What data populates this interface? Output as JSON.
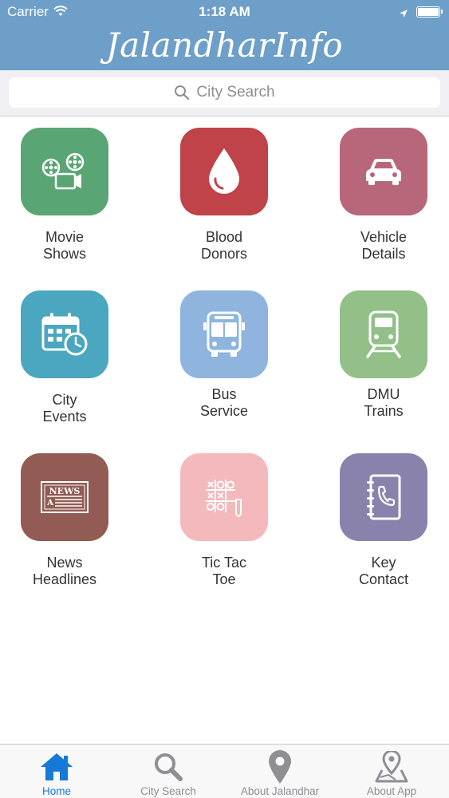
{
  "status_bar": {
    "carrier": "Carrier",
    "time": "1:18 AM"
  },
  "header": {
    "title": "JalandharInfo"
  },
  "search": {
    "placeholder": "City Search"
  },
  "grid": [
    {
      "label": "Movie\nShows",
      "icon": "film-reel-icon",
      "color": "#5aa574"
    },
    {
      "label": "Blood\nDonors",
      "icon": "blood-drop-icon",
      "color": "#c0434a"
    },
    {
      "label": "Vehicle\nDetails",
      "icon": "car-icon",
      "color": "#b76779"
    },
    {
      "label": "City\nEvents",
      "icon": "calendar-icon",
      "color": "#4aa7bf"
    },
    {
      "label": "Bus\nService",
      "icon": "bus-icon",
      "color": "#8fb5df"
    },
    {
      "label": "DMU\nTrains",
      "icon": "train-icon",
      "color": "#93bf89"
    },
    {
      "label": "News\nHeadlines",
      "icon": "newspaper-icon",
      "color": "#925b53"
    },
    {
      "label": "Tic Tac\nToe",
      "icon": "tic-tac-toe-icon",
      "color": "#f4b9bc"
    },
    {
      "label": "Key\nContact",
      "icon": "phone-book-icon",
      "color": "#8882ad"
    }
  ],
  "tabs": [
    {
      "label": "Home",
      "icon": "home-icon",
      "active": true
    },
    {
      "label": "City Search",
      "icon": "search-icon",
      "active": false
    },
    {
      "label": "About Jalandhar",
      "icon": "map-pin-icon",
      "active": false
    },
    {
      "label": "About App",
      "icon": "map-location-icon",
      "active": false
    }
  ],
  "colors": {
    "header": "#6d9fc8",
    "tab_active": "#1679d8",
    "tab_inactive": "#8e8e93"
  }
}
